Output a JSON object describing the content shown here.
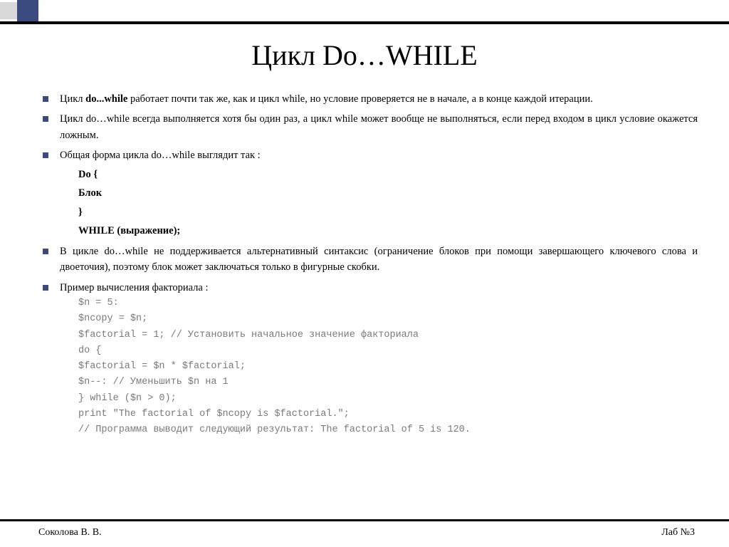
{
  "title": "Цикл Do…WHILE",
  "bullets": {
    "b1_pre": "Цикл ",
    "b1_bold": "do...while",
    "b1_post": " работает почти так же, как и цикл while, но условие проверяется не в начале, а в конце каждой итерации.",
    "b2": "Цикл do…while всегда выполняется хотя бы один раз, а цикл while может вообще не выполняться, если перед входом в цикл условие окажется ложным.",
    "b3": "Общая форма цикла do…while выглядит так :",
    "syntax": {
      "l1": "Do {",
      "l2": "Блок",
      "l3": "}",
      "l4": "WHILE (выражение);"
    },
    "b4": "В цикле do…while не поддерживается альтернативный синтаксис (ограничение блоков при помощи завершающего ключевого слова и двоеточия), поэтому блок может заключаться только в фигурные скобки.",
    "b5": "Пример вычисления факториала :",
    "code": {
      "c1": "$n = 5:",
      "c2": "$ncopy = $n;",
      "c3": "$factorial = 1; // Установить начальное значение факториала",
      "c4": "do {",
      "c5": "$factorial = $n * $factorial;",
      "c6": "$n--: // Уменьшить $n на 1",
      "c7": "} while ($n > 0);",
      "c8": "print \"The factorial of $ncopy is $factorial.\";",
      "c9": "// Программа выводит следующий результат: The factorial of 5 is 120."
    }
  },
  "footer": {
    "left": "Соколова  В. В.",
    "right": "Лаб №3"
  }
}
